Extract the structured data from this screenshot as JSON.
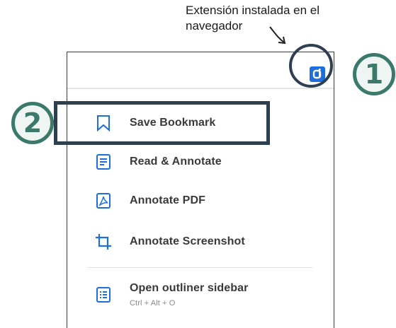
{
  "annotation": {
    "line1": "Extensión instalada en el",
    "line2": "navegador"
  },
  "extension": {
    "icon": "hypothesis-d-icon",
    "color": "#1e6ee0"
  },
  "badges": {
    "one": "1",
    "two": "2",
    "color": "#3b7a6a"
  },
  "menu": {
    "items": [
      {
        "label": "Save Bookmark",
        "icon": "bookmark-icon"
      },
      {
        "label": "Read & Annotate",
        "icon": "document-icon"
      },
      {
        "label": "Annotate PDF",
        "icon": "pdf-icon"
      },
      {
        "label": "Annotate Screenshot",
        "icon": "crop-icon"
      },
      {
        "label": "Open outliner sidebar",
        "shortcut": "Ctrl + Alt + O",
        "icon": "outline-list-icon"
      }
    ]
  },
  "colors": {
    "icon_blue": "#1e6ee0",
    "dark_outline": "#2e3f4f"
  }
}
